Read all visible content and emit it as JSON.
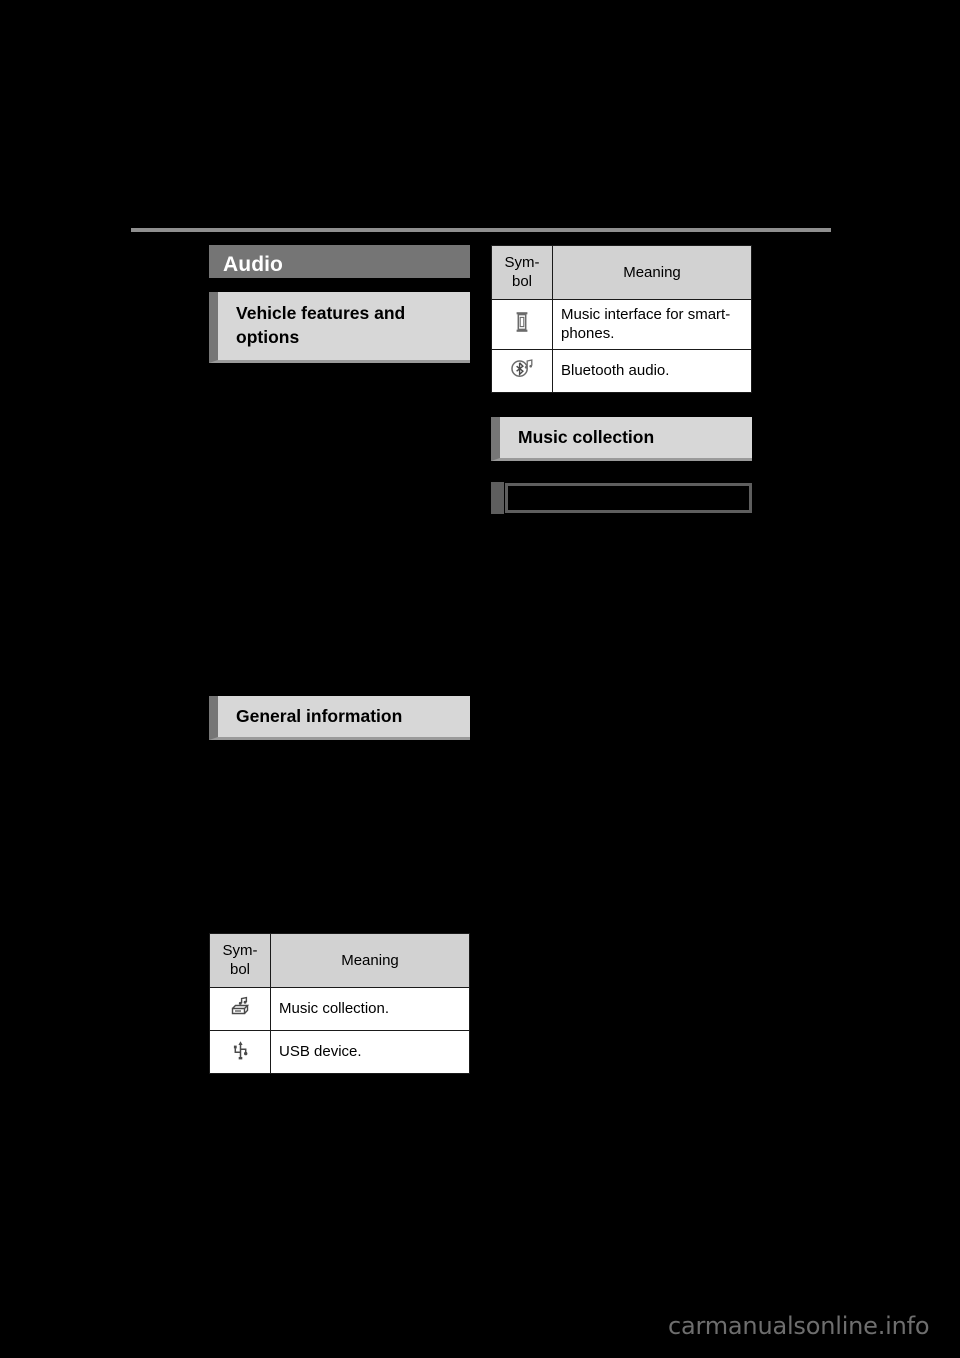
{
  "page": {
    "background_color": "#000000",
    "rule_color": "#8f8f8f",
    "watermark": "carmanualsonline.info"
  },
  "left_column": {
    "chapter_title": "Audio",
    "section_heading": "Vehicle features and options",
    "general_information_heading": "General information",
    "symbol_table": {
      "headers": [
        "Sym-\nbol",
        "Meaning"
      ],
      "header_symbol": "Sym- bol",
      "header_meaning": "Meaning",
      "rows": [
        {
          "icon": "music-collection-icon",
          "meaning": "Music collection."
        },
        {
          "icon": "usb-device-icon",
          "meaning": "USB device."
        }
      ]
    }
  },
  "right_column": {
    "symbol_table": {
      "header_symbol": "Sym- bol",
      "header_meaning": "Meaning",
      "rows": [
        {
          "icon": "smartphone-music-interface-icon",
          "meaning": "Music interface for smart-phones."
        },
        {
          "icon": "bluetooth-audio-icon",
          "meaning": "Bluetooth audio."
        }
      ]
    },
    "music_collection_heading": "Music collection",
    "redacted_subheading": ""
  },
  "colors": {
    "chapter_bar": "#757575",
    "section_box": "#d7d7d7",
    "section_tab": "#767676",
    "table_header": "#d2d2d2",
    "table_body": "#ffffff",
    "text": "#000000"
  }
}
